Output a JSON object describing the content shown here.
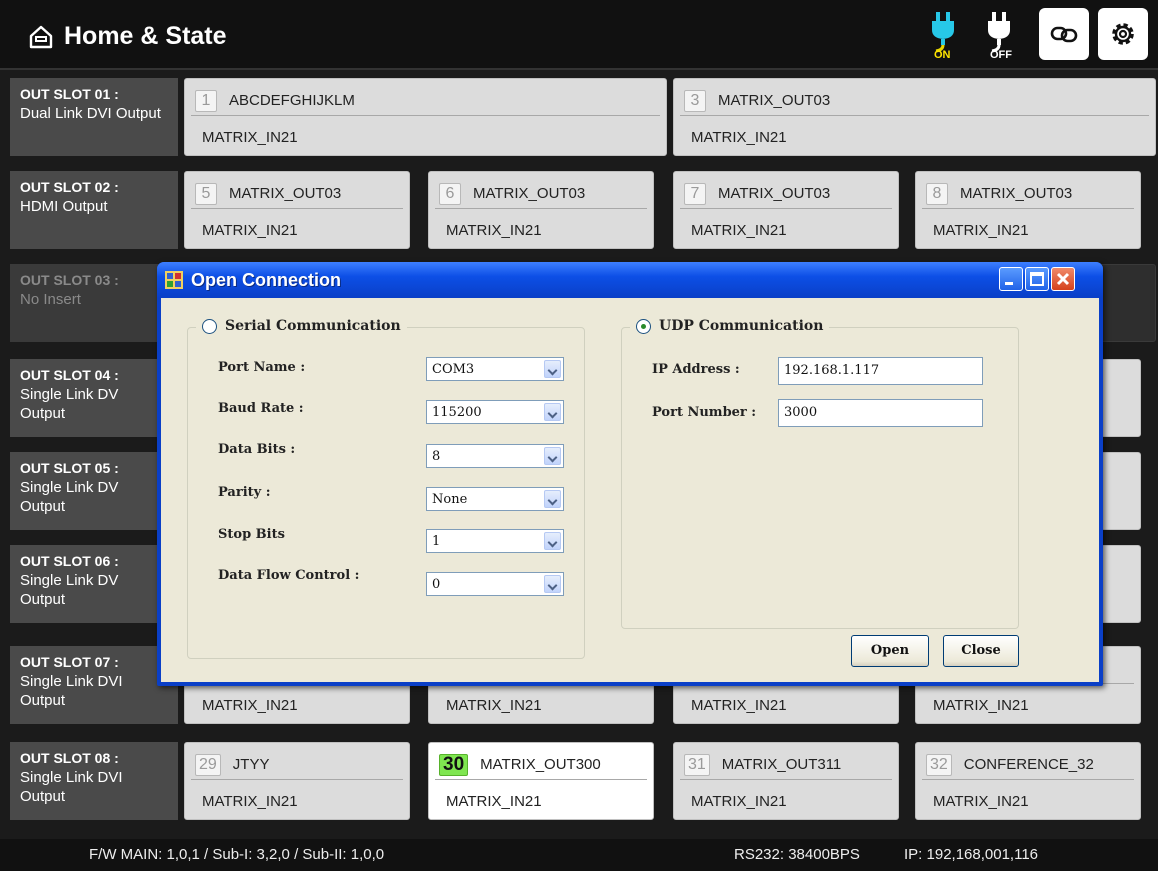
{
  "header": {
    "title": "Home & State",
    "power_on_label": "ON",
    "power_off_label": "OFF",
    "icons": [
      "home-icon",
      "power-on-icon",
      "power-off-icon",
      "link-icon",
      "gear-icon"
    ]
  },
  "slots": [
    {
      "code": "OUT SLOT 01 :",
      "type": "Dual Link DVI Output",
      "outputs": [
        {
          "num": "1",
          "name": "ABCDEFGHIJKLM",
          "input": "MATRIX_IN21"
        },
        {
          "num": "3",
          "name": "MATRIX_OUT03",
          "input": "MATRIX_IN21"
        }
      ]
    },
    {
      "code": "OUT SLOT 02 :",
      "type": "HDMI Output",
      "outputs": [
        {
          "num": "5",
          "name": "MATRIX_OUT03",
          "input": "MATRIX_IN21"
        },
        {
          "num": "6",
          "name": "MATRIX_OUT03",
          "input": "MATRIX_IN21"
        },
        {
          "num": "7",
          "name": "MATRIX_OUT03",
          "input": "MATRIX_IN21"
        },
        {
          "num": "8",
          "name": "MATRIX_OUT03",
          "input": "MATRIX_IN21"
        }
      ]
    },
    {
      "code": "OUT SLOT 03 :",
      "type": "No Insert"
    },
    {
      "code": "OUT SLOT 04 :",
      "type": "Single Link DV",
      "type2": "Output"
    },
    {
      "code": "OUT SLOT 05 :",
      "type": "Single Link DV",
      "type2": "Output"
    },
    {
      "code": "OUT SLOT 06 :",
      "type": "Single Link DV",
      "type2": "Output"
    },
    {
      "code": "OUT SLOT 07 :",
      "type": "Single Link DVI Output",
      "outputs": [
        {
          "input": "MATRIX_IN21"
        },
        {
          "input": "MATRIX_IN21"
        },
        {
          "input": "MATRIX_IN21"
        },
        {
          "input": "MATRIX_IN21"
        }
      ]
    },
    {
      "code": "OUT SLOT 08 :",
      "type": "Single Link DVI Output",
      "outputs": [
        {
          "num": "29",
          "name": "JTYY",
          "input": "MATRIX_IN21"
        },
        {
          "num": "30",
          "name": "MATRIX_OUT300",
          "input": "MATRIX_IN21",
          "selected": true
        },
        {
          "num": "31",
          "name": "MATRIX_OUT311",
          "input": "MATRIX_IN21"
        },
        {
          "num": "32",
          "name": "CONFERENCE_32",
          "input": "MATRIX_IN21"
        }
      ]
    }
  ],
  "status_bar": {
    "firmware": "F/W MAIN: 1,0,1 / Sub-I: 3,2,0 / Sub-II: 1,0,0",
    "rs232": "RS232: 38400BPS",
    "ip": "IP: 192,168,001,116"
  },
  "dialog": {
    "title": "Open Connection",
    "serial": {
      "legend": "Serial Communication",
      "selected": false,
      "fields": [
        {
          "label": "Port Name :",
          "value": "COM3"
        },
        {
          "label": "Baud Rate :",
          "value": "115200"
        },
        {
          "label": "Data Bits :",
          "value": "8"
        },
        {
          "label": "Parity :",
          "value": "None"
        },
        {
          "label": "Stop Bits",
          "value": "1"
        },
        {
          "label": "Data Flow Control :",
          "value": "0"
        }
      ]
    },
    "udp": {
      "legend": "UDP Communication",
      "selected": true,
      "ip_label": "IP Address :",
      "ip_value": "192.168.1.117",
      "port_label": "Port Number :",
      "port_value": "3000"
    },
    "open_label": "Open",
    "close_label": "Close"
  }
}
